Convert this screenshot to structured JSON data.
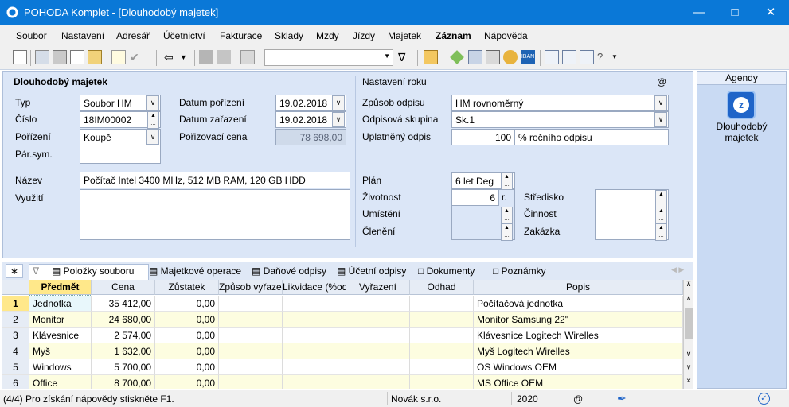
{
  "window": {
    "title": "POHODA Komplet - [Dlouhodobý majetek]"
  },
  "menu": [
    "Soubor",
    "Nastavení",
    "Adresář",
    "Účetnictví",
    "Fakturace",
    "Sklady",
    "Mzdy",
    "Jízdy",
    "Majetek",
    "Záznam",
    "Nápověda"
  ],
  "form": {
    "section_title": "Dlouhodobý majetek",
    "typ_label": "Typ",
    "typ_value": "Soubor HM",
    "cislo_label": "Číslo",
    "cislo_value": "18IM00002",
    "porizeni_label": "Pořízení",
    "porizeni_value": "Koupě",
    "parsym_label": "Pár.sym.",
    "datum_porizeni_label": "Datum pořízení",
    "datum_porizeni_value": "19.02.2018",
    "datum_zarazeni_label": "Datum zařazení",
    "datum_zarazeni_value": "19.02.2018",
    "porizovaci_cena_label": "Pořizovací cena",
    "porizovaci_cena_value": "78 698,00",
    "nazev_label": "Název",
    "nazev_value": "Počítač Intel 3400 MHz, 512 MB RAM, 120 GB HDD",
    "vyuziti_label": "Využití",
    "nastaveni_roku": "Nastavení roku",
    "at_icon": "@",
    "zpusob_odpisu_label": "Způsob odpisu",
    "zpusob_odpisu_value": "HM rovnoměrný",
    "odpisova_skupina_label": "Odpisová skupina",
    "odpisova_skupina_value": "Sk.1",
    "uplatneny_odpis_label": "Uplatněný odpis",
    "uplatneny_odpis_value": "100",
    "uplatneny_odpis_unit": "% ročního odpisu",
    "plan_label": "Plán",
    "plan_value": "6 let Deg",
    "zivotnost_label": "Životnost",
    "zivotnost_value": "6",
    "zivotnost_unit": "r.",
    "umisteni_label": "Umístění",
    "cleneni_label": "Členění",
    "stredisko_label": "Středisko",
    "cinnost_label": "Činnost",
    "zakazka_label": "Zakázka"
  },
  "agendy": {
    "title": "Agendy",
    "item": "Dlouhodobý majetek"
  },
  "tabs": [
    "Položky souboru",
    "Majetkové operace",
    "Daňové odpisy",
    "Účetní odpisy",
    "Dokumenty",
    "Poznámky"
  ],
  "grid": {
    "columns": [
      "Předmět",
      "Cena",
      "Zůstatek",
      "Způsob vyřazení",
      "Likvidace (%od",
      "Vyřazení",
      "Odhad",
      "Popis"
    ],
    "rows": [
      {
        "n": "1",
        "predmet": "Jednotka",
        "cena": "35 412,00",
        "zustatek": "0,00",
        "popis": "Počítačová jednotka"
      },
      {
        "n": "2",
        "predmet": "Monitor",
        "cena": "24 680,00",
        "zustatek": "0,00",
        "popis": "Monitor Samsung 22\""
      },
      {
        "n": "3",
        "predmet": "Klávesnice",
        "cena": "2 574,00",
        "zustatek": "0,00",
        "popis": "Klávesnice Logitech Wirelles"
      },
      {
        "n": "4",
        "predmet": "Myš",
        "cena": "1 632,00",
        "zustatek": "0,00",
        "popis": "Myš Logitech Wirelles"
      },
      {
        "n": "5",
        "predmet": "Windows",
        "cena": "5 700,00",
        "zustatek": "0,00",
        "popis": "OS Windows OEM"
      },
      {
        "n": "6",
        "predmet": "Office",
        "cena": "8 700,00",
        "zustatek": "0,00",
        "popis": "MS Office OEM"
      }
    ]
  },
  "status": {
    "hint": "(4/4) Pro získání nápovědy stiskněte F1.",
    "company": "Novák s.r.o.",
    "year": "2020",
    "at": "@"
  },
  "colors": {
    "titlebar": "#0a78d7",
    "panel": "#dbe6f7",
    "grid_highlight": "#fdfde0",
    "header_yellow": "#ffe88a"
  }
}
